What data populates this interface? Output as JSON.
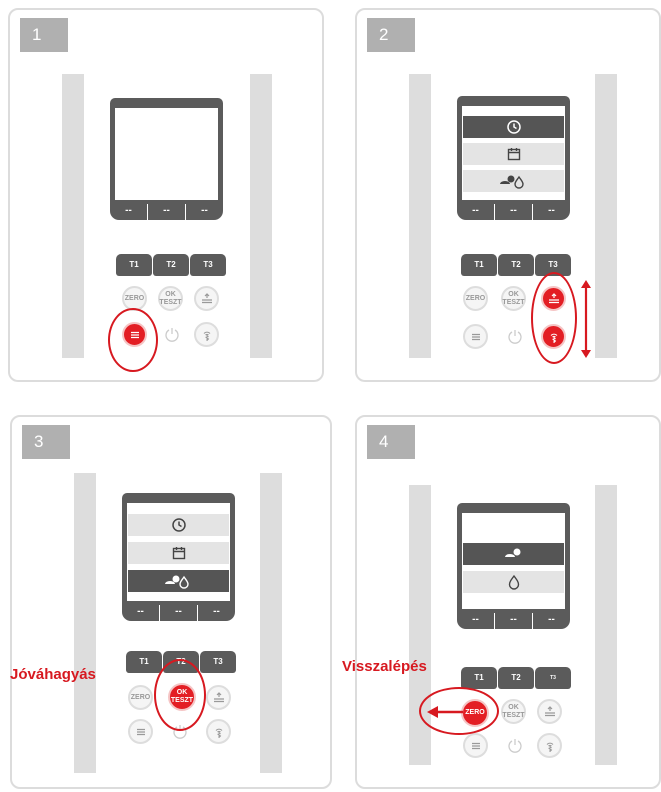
{
  "steps": [
    "1",
    "2",
    "3",
    "4"
  ],
  "display": {
    "dash": "--"
  },
  "keys": {
    "t1": "T1",
    "t2": "T2",
    "t3": "T3",
    "t3_small": "T3"
  },
  "buttons": {
    "zero": "ZERO",
    "ok": "OK",
    "teszt": "TESZT"
  },
  "labels": {
    "confirm": "Jóváhagyás",
    "back": "Visszalépés"
  },
  "colors": {
    "accent": "#d71920",
    "button_red": "#e31e24",
    "device": "#5b5b5b"
  },
  "icons": [
    "menu-icon",
    "power-icon",
    "level-icon",
    "bluetooth-icon",
    "clock-icon",
    "calendar-icon",
    "chemicals-icon",
    "drop-icon",
    "arrow-up-down-icon",
    "arrow-left-icon"
  ]
}
